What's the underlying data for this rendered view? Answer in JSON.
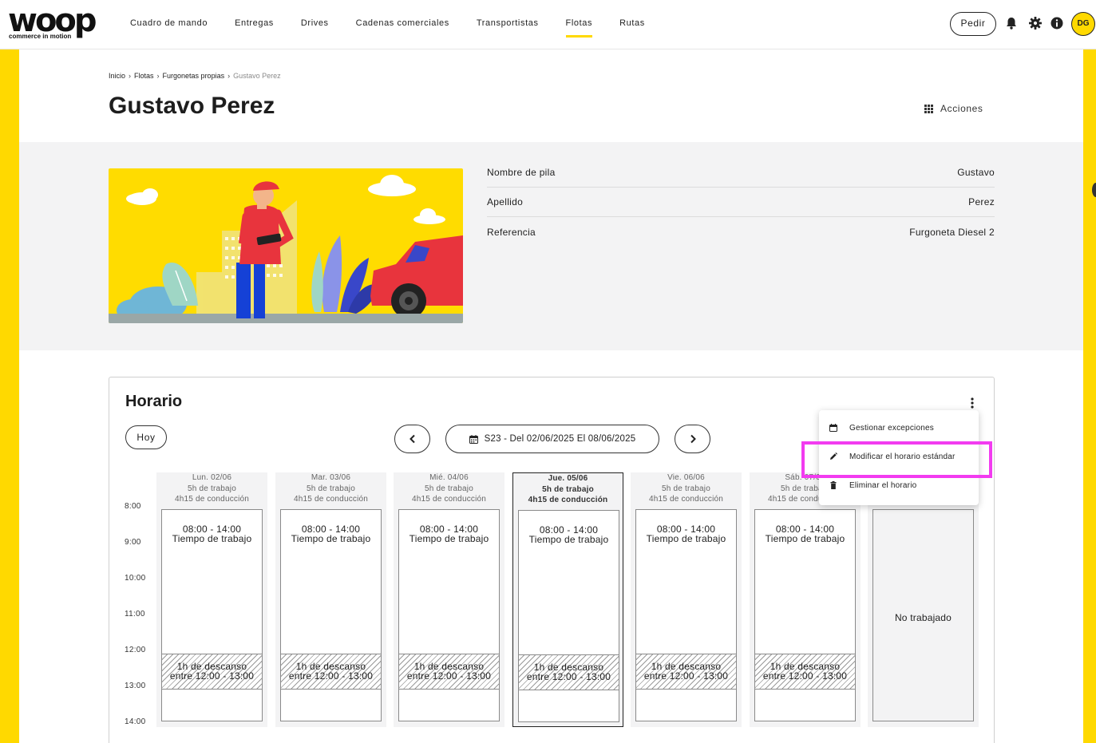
{
  "brand": {
    "logo_text": "woop",
    "tagline": "commerce in motion"
  },
  "nav": {
    "items": [
      {
        "label": "Cuadro de mando"
      },
      {
        "label": "Entregas"
      },
      {
        "label": "Drives"
      },
      {
        "label": "Cadenas comerciales"
      },
      {
        "label": "Transportistas"
      },
      {
        "label": "Flotas",
        "active": true
      },
      {
        "label": "Rutas"
      }
    ],
    "order_button": "Pedir",
    "icons": [
      "bell-icon",
      "gear-icon",
      "info-icon"
    ],
    "avatar_initials": "DG"
  },
  "breadcrumb": [
    "Inicio",
    "Flotas",
    "Furgonetas propias",
    "Gustavo Perez"
  ],
  "page": {
    "title": "Gustavo Perez",
    "actions_label": "Acciones"
  },
  "info": [
    {
      "label": "Nombre de pila",
      "value": "Gustavo"
    },
    {
      "label": "Apellido",
      "value": "Perez"
    },
    {
      "label": "Referencia",
      "value": "Furgoneta Diesel 2"
    }
  ],
  "schedule": {
    "title": "Horario",
    "today_button": "Hoy",
    "week_label": "S23 - Del 02/06/2025 El 08/06/2025",
    "hours": [
      "8:00",
      "9:00",
      "10:00",
      "11:00",
      "12:00",
      "13:00",
      "14:00"
    ],
    "days": [
      {
        "date": "Lun. 02/06",
        "work": "5h de trabajo",
        "driving": "4h15 de conducción",
        "time": "08:00 - 14:00",
        "type": "Tiempo de trabajo",
        "break1": "1h de descanso",
        "break2": "entre 12:00 - 13:00"
      },
      {
        "date": "Mar. 03/06",
        "work": "5h de trabajo",
        "driving": "4h15 de conducción",
        "time": "08:00 - 14:00",
        "type": "Tiempo de trabajo",
        "break1": "1h de descanso",
        "break2": "entre 12:00 - 13:00"
      },
      {
        "date": "Mié. 04/06",
        "work": "5h de trabajo",
        "driving": "4h15 de conducción",
        "time": "08:00 - 14:00",
        "type": "Tiempo de trabajo",
        "break1": "1h de descanso",
        "break2": "entre 12:00 - 13:00"
      },
      {
        "date": "Jue. 05/06",
        "work": "5h de trabajo",
        "driving": "4h15 de conducción",
        "time": "08:00 - 14:00",
        "type": "Tiempo de trabajo",
        "break1": "1h de descanso",
        "break2": "entre 12:00 - 13:00",
        "today": true
      },
      {
        "date": "Vie. 06/06",
        "work": "5h de trabajo",
        "driving": "4h15 de conducción",
        "time": "08:00 - 14:00",
        "type": "Tiempo de trabajo",
        "break1": "1h de descanso",
        "break2": "entre 12:00 - 13:00"
      },
      {
        "date": "Sáb. 07/06",
        "work": "5h de trabajo",
        "driving": "4h15 de conducción",
        "time": "08:00 - 14:00",
        "type": "Tiempo de trabajo",
        "break1": "1h de descanso",
        "break2": "entre 12:00 - 13:00"
      },
      {
        "off": "No trabajado"
      }
    ]
  },
  "menu": {
    "items": [
      {
        "label": "Gestionar excepciones",
        "icon": "calendar-icon"
      },
      {
        "label": "Modificar el horario estándar",
        "icon": "pencil-icon"
      },
      {
        "label": "Eliminar el horario",
        "icon": "trash-icon"
      }
    ]
  },
  "colors": {
    "accent": "#ffd900",
    "highlight": "#f23bf0",
    "car": "#e8343d",
    "person_shirt": "#e8343d",
    "person_pants": "#1541d6"
  }
}
